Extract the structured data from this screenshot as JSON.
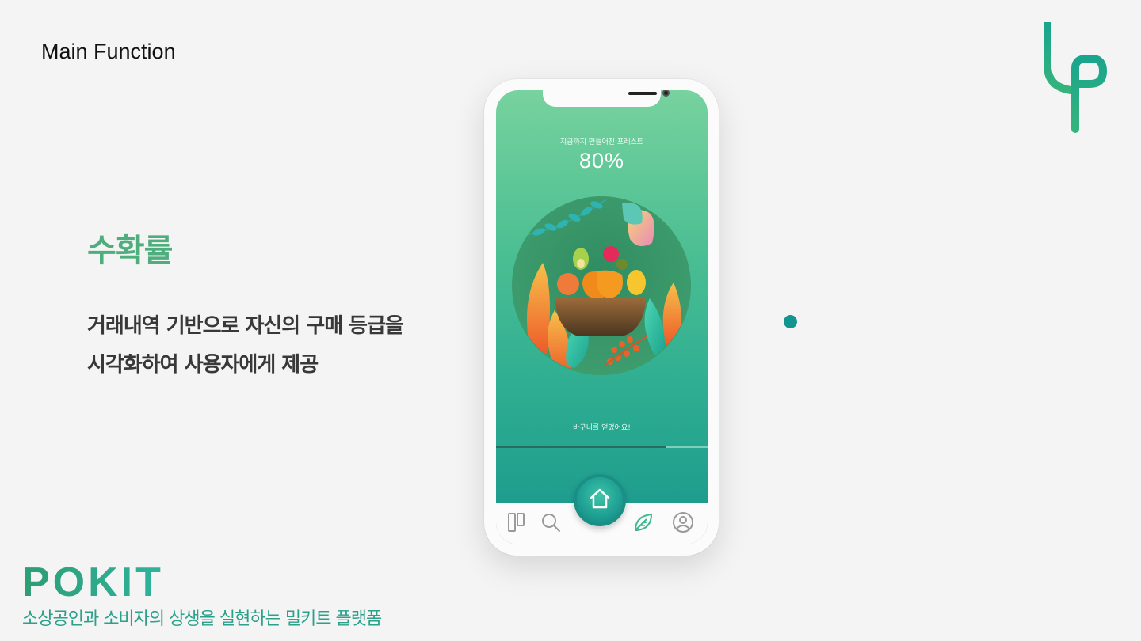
{
  "header": {
    "section_title": "Main Function"
  },
  "feature": {
    "title": "수확률",
    "description_line1": "거래내역 기반으로 자신의 구매 등급을",
    "description_line2": "시각화하여 사용자에게 제공"
  },
  "brand": {
    "name": "POKIT",
    "tagline": "소상공인과 소비자의 상생을 실현하는 밀키트 플랫폼",
    "accent_color": "#2fa88a"
  },
  "phone": {
    "forest_label": "지금까지 만들어진 포레스트",
    "forest_percent": "80%",
    "reward_message": "바구니를 얻었어요!",
    "progress": 0.8,
    "tabs": [
      {
        "name": "Board",
        "icon": "board-icon"
      },
      {
        "name": "Search",
        "icon": "search-icon"
      },
      {
        "name": "Home",
        "icon": "home-icon"
      },
      {
        "name": "Forest",
        "icon": "leaf-icon"
      },
      {
        "name": "Profile",
        "icon": "profile-icon"
      }
    ]
  }
}
